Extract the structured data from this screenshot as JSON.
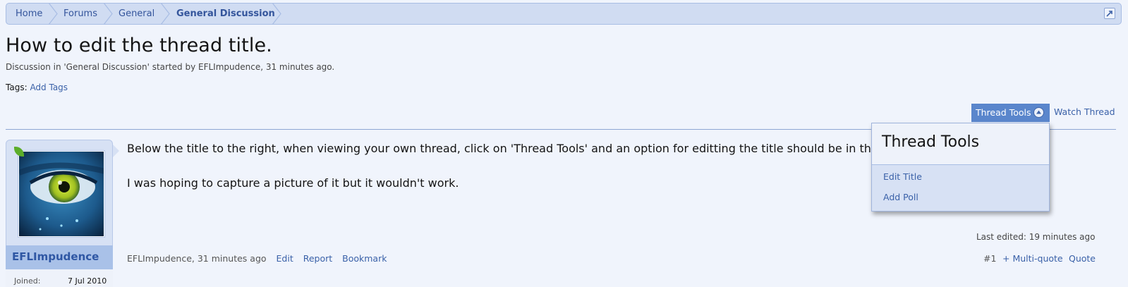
{
  "breadcrumb": {
    "items": [
      "Home",
      "Forums",
      "General",
      "General Discussion"
    ]
  },
  "thread": {
    "title": "How to edit the thread title.",
    "meta": "Discussion in 'General Discussion' started by EFLImpudence, 31 minutes ago.",
    "tags_label": "Tags:",
    "add_tags": "Add Tags"
  },
  "controls": {
    "thread_tools": "Thread Tools",
    "watch_thread": "Watch Thread"
  },
  "dropdown": {
    "title": "Thread Tools",
    "items": [
      "Edit Title",
      "Add Poll"
    ]
  },
  "post": {
    "username": "EFLImpudence",
    "joined_label": "Joined:",
    "joined_value": "7 Jul 2010",
    "line1": "Below the title to the right, when viewing your own thread, click on 'Thread Tools' and an option for editting the title should be in the drop down box.",
    "line2": "I was hoping to capture a picture of it but it wouldn't work.",
    "last_edited": "Last edited: 19 minutes ago",
    "author_time": "EFLImpudence, 31 minutes ago",
    "actions": [
      "Edit",
      "Report",
      "Bookmark"
    ],
    "number": "#1",
    "multiquote": "+ Multi-quote",
    "quote": "Quote"
  },
  "colors": {
    "accent": "#5a86cc",
    "link": "#3a61a8",
    "breadcrumb_bg": "#d0dcf2",
    "page_bg": "#f0f4fc"
  }
}
